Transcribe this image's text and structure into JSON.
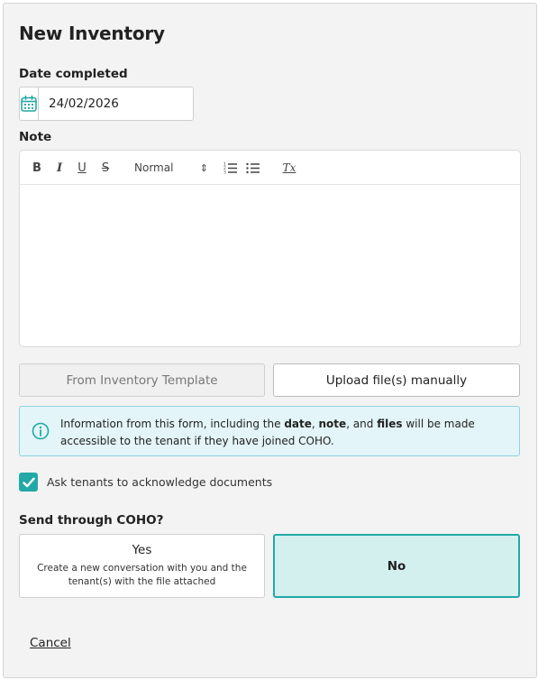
{
  "form": {
    "title": "New Inventory",
    "date_label": "Date completed",
    "date_value": "24/02/2026",
    "note_label": "Note"
  },
  "editor": {
    "bold": "B",
    "italic": "I",
    "underline": "U",
    "strike": "S",
    "header_value": "Normal",
    "header_arrow": "⇕",
    "clean": "Tx"
  },
  "buttons": {
    "template_label": "From Inventory Template",
    "upload_label": "Upload file(s) manually"
  },
  "info": {
    "part1": "Information from this form, including the ",
    "date_word": "date",
    "comma1": ", ",
    "note_word": "note",
    "part2": ", and ",
    "files_word": "files",
    "part3": " will be made accessible to the tenant if they have joined COHO."
  },
  "acknowledge": {
    "label": "Ask tenants to acknowledge documents",
    "checked": true
  },
  "send": {
    "label": "Send through COHO?",
    "yes_title": "Yes",
    "yes_desc": "Create a new conversation with you and the tenant(s) with the file attached",
    "no_title": "No",
    "selected": "No"
  },
  "cancel_label": "Cancel",
  "colors": {
    "accent": "#22a9a6",
    "selected_bg": "#d3f0ef",
    "info_bg": "#e3f5f8",
    "info_border": "#8fd3e0"
  },
  "icons": {
    "date": "calendar-icon",
    "info": "info-circle-icon",
    "check": "checkmark-icon"
  }
}
